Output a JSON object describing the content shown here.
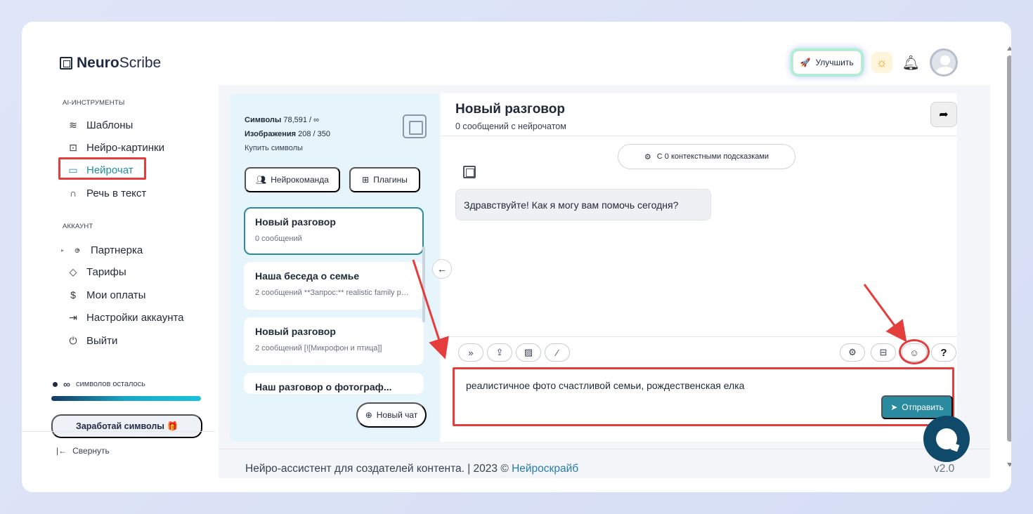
{
  "app": {
    "logo_bold": "Neuro",
    "logo_rest": "Scribe"
  },
  "topbar": {
    "upgrade_label": "Улучшить"
  },
  "sidebar": {
    "section_tools": "AI-ИНСТРУМЕНТЫ",
    "tools": [
      {
        "label": "Шаблоны",
        "icon": "layers-icon"
      },
      {
        "label": "Нейро-картинки",
        "icon": "image-icon"
      },
      {
        "label": "Нейрочат",
        "icon": "chat-icon",
        "active": true
      },
      {
        "label": "Речь в текст",
        "icon": "headphones-icon"
      }
    ],
    "section_account": "АККАУНТ",
    "account": [
      {
        "label": "Партнерка",
        "icon": "users-icon"
      },
      {
        "label": "Тарифы",
        "icon": "tag-icon"
      },
      {
        "label": "Мои оплаты",
        "icon": "dollar-icon"
      },
      {
        "label": "Настройки аккаунта",
        "icon": "login-icon"
      },
      {
        "label": "Выйти",
        "icon": "power-icon"
      }
    ],
    "symbols_symbol": "∞",
    "symbols_text": "символов осталось",
    "earn_label": "Заработай символы 🎁",
    "collapse_label": "Свернуть"
  },
  "chat_list": {
    "stats_symbols_label": "Символы",
    "stats_symbols_value": "78,591 / ∞",
    "stats_images_label": "Изображения",
    "stats_images_value": "208 / 350",
    "buy_label": "Купить символы",
    "team_label": "Нейрокоманда",
    "plugins_label": "Плагины",
    "chats": [
      {
        "title": "Новый разговор",
        "subtitle": "0 сообщений"
      },
      {
        "title": "Наша беседа о семье",
        "subtitle": "2 сообщений   **Запрос:** realistic family photo"
      },
      {
        "title": "Новый разговор",
        "subtitle": "2 сообщений   [![Микрофон и птица]]"
      },
      {
        "title": "Наш разговор о фотограф...",
        "subtitle": ""
      }
    ],
    "new_chat_label": "Новый чат"
  },
  "chat": {
    "title": "Новый разговор",
    "subtitle": "0 сообщений с нейрочатом",
    "context_label": "С 0 контекстными подсказками",
    "bot_message": "Здравствуйте! Как я могу вам помочь сегодня?",
    "input_value": "реалистичное фото счастливой семьи, рождественская елка",
    "send_label": "Отправить",
    "help_label": "?"
  },
  "footer": {
    "text": "Нейро-ассистент для создателей контента.  | 2023 © ",
    "link": "Нейроскрайб",
    "version": "v2.0"
  },
  "colors": {
    "accent": "#2a8aa0",
    "highlight": "#e53c3c",
    "panel": "#e6f4fb"
  }
}
